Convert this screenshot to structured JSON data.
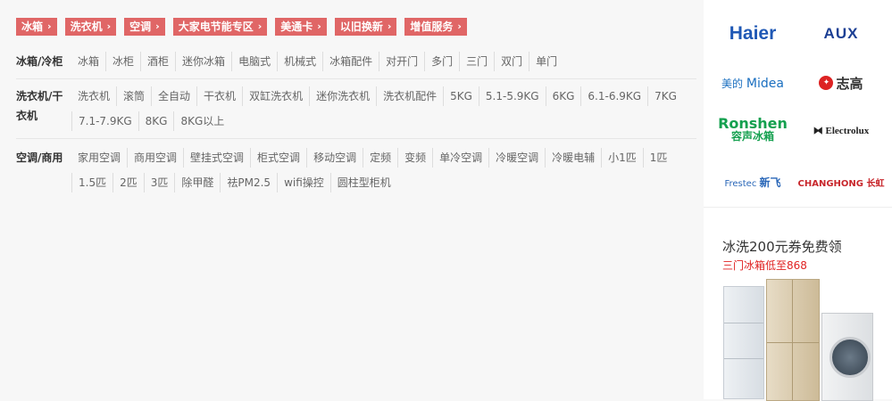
{
  "tags": [
    "冰箱",
    "洗衣机",
    "空调",
    "大家电节能专区",
    "美通卡",
    "以旧换新",
    "增值服务"
  ],
  "rows": [
    {
      "title": "冰箱/冷柜",
      "items": [
        "冰箱",
        "冰柜",
        "酒柜",
        "迷你冰箱",
        "电脑式",
        "机械式",
        "冰箱配件",
        "对开门",
        "多门",
        "三门",
        "双门",
        "单门"
      ]
    },
    {
      "title": "洗衣机/干衣机",
      "items": [
        "洗衣机",
        "滚筒",
        "全自动",
        "干衣机",
        "双缸洗衣机",
        "迷你洗衣机",
        "洗衣机配件",
        "5KG",
        "5.1-5.9KG",
        "6KG",
        "6.1-6.9KG",
        "7KG",
        "7.1-7.9KG",
        "8KG",
        "8KG以上"
      ]
    },
    {
      "title": "空调/商用",
      "items": [
        "家用空调",
        "商用空调",
        "壁挂式空调",
        "柜式空调",
        "移动空调",
        "定频",
        "变频",
        "单冷空调",
        "冷暖空调",
        "冷暖电辅",
        "小1匹",
        "1匹",
        "1.5匹",
        "2匹",
        "3匹",
        "除甲醛",
        "祛PM2.5",
        "wifi操控",
        "圆柱型柜机"
      ]
    }
  ],
  "brands": {
    "haier": "Haier",
    "aux": "AUX",
    "midea_cn": "美的",
    "midea_en": "Midea",
    "chigo_mark": "CHIGO",
    "chigo": "志高",
    "ronshen_en": "Ronshen",
    "ronshen_cn": "容声冰箱",
    "electrolux": "Electrolux",
    "frestec_en": "Frestec",
    "frestec_cn": "新飞",
    "changhong": "CHANGHONG 长虹"
  },
  "promo": {
    "title": "冰洗200元券免费领",
    "subtitle": "三门冰箱低至868"
  },
  "colors": {
    "tag_bg": "#e06666",
    "promo_sub": "#e02222"
  },
  "icons": {
    "tag_arrow": "chevron-right-icon",
    "electrolux_mark": "electrolux-logo-icon"
  }
}
